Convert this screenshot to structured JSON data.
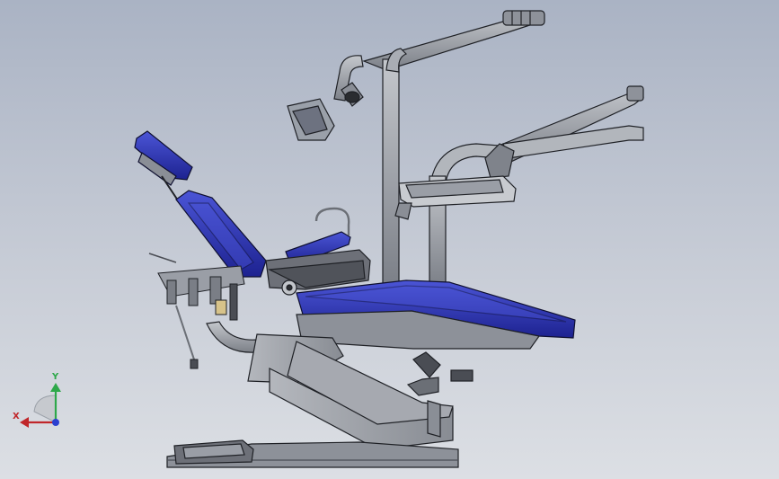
{
  "viewport": {
    "background_top": "#aab3c4",
    "background_bottom": "#dcdfe4",
    "model_subject": "dental-chair-assembly"
  },
  "colors": {
    "upholstery": "#2a2fa8",
    "upholstery_highlight": "#4b55d6",
    "metal": "#9a9ea6",
    "metal_dark": "#6b6f76",
    "edge": "#1f2126",
    "x_axis": "#c0262a",
    "y_axis": "#2ea84a",
    "z_axis": "#2b3fd0"
  },
  "triad": {
    "x_label": "X",
    "y_label": "Y"
  }
}
